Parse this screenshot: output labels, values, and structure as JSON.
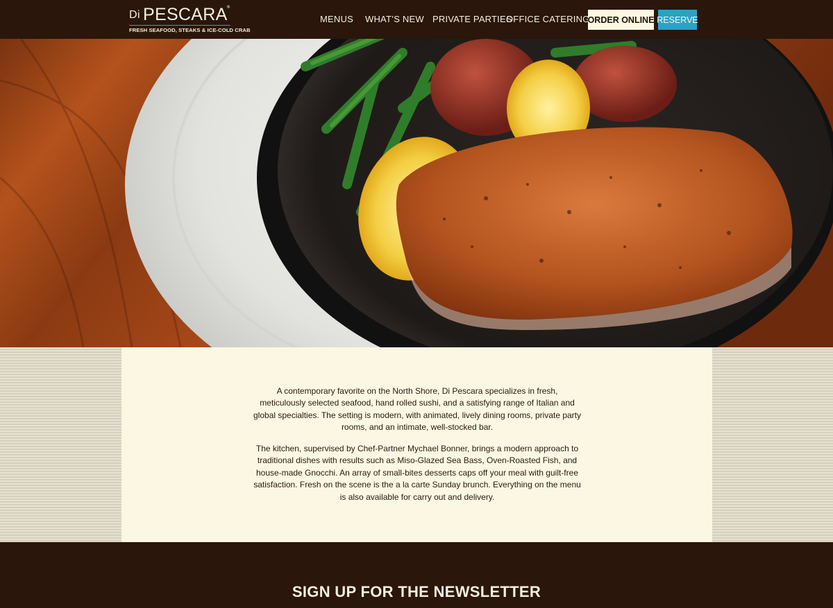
{
  "header": {
    "logo": {
      "prefix": "Di",
      "name": "PESCARA",
      "registered": "®",
      "tagline": "FRESH SEAFOOD, STEAKS & ICE-COLD CRAB"
    },
    "nav": [
      {
        "label": "MENUS"
      },
      {
        "label": "WHAT’S NEW"
      },
      {
        "label": "PRIVATE PARTIES"
      },
      {
        "label": "OFFICE CATERING"
      }
    ],
    "order_label": "ORDER ONLINE",
    "reserve_label": "RESERVE"
  },
  "colors": {
    "header_bg": "#2a160a",
    "accent": "#2aa2c6",
    "cream": "#fbf7e3"
  },
  "about": {
    "paragraph_1": "A contemporary favorite on the North Shore, Di Pescara specializes in fresh, meticulously selected seafood, hand rolled sushi, and a satisfying range of Italian and global specialties. The setting is modern, with animated, lively dining rooms, private party rooms, and an intimate, well-stocked bar.",
    "paragraph_2": "The kitchen, supervised by Chef-Partner Mychael Bonner, brings a modern approach to traditional dishes with results such as Miso-Glazed Sea Bass, Oven-Roasted Fish, and house-made Gnocchi. An array of small-bites desserts caps off your meal with guilt-free satisfaction. Fresh on the scene is the a la carte Sunday brunch. Everything on the menu is also available for carry out and delivery."
  },
  "footer": {
    "newsletter_title": "SIGN UP FOR THE NEWSLETTER"
  }
}
